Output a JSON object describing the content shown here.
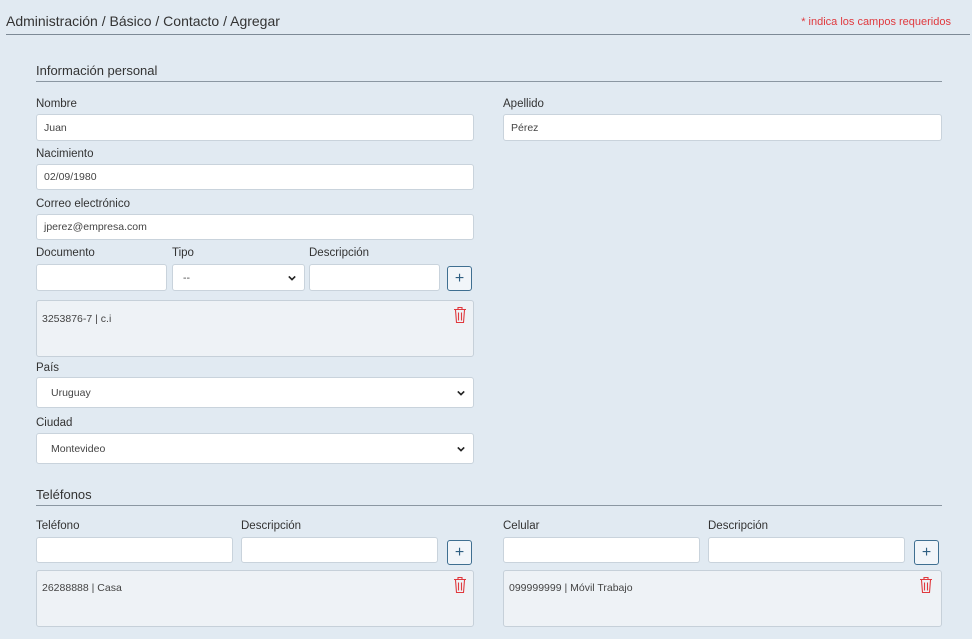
{
  "header": {
    "breadcrumb": "Administración / Básico / Contacto / Agregar",
    "required_note": "* indica los campos requeridos"
  },
  "personal": {
    "title": "Información personal",
    "nombre_label": "Nombre",
    "nombre_value": "Juan",
    "apellido_label": "Apellido",
    "apellido_value": "Pérez",
    "nacimiento_label": "Nacimiento",
    "nacimiento_value": "02/09/1980",
    "correo_label": "Correo electrónico",
    "correo_value": "jperez@empresa.com",
    "documento_label": "Documento",
    "documento_value": "",
    "tipo_label": "Tipo",
    "tipo_value": "--",
    "descripcion_label": "Descripción",
    "descripcion_value": "",
    "add_symbol": "+",
    "documents": [
      "3253876-7 | c.i"
    ],
    "pais_label": "País",
    "pais_value": "Uruguay",
    "ciudad_label": "Ciudad",
    "ciudad_value": "Montevideo"
  },
  "telefonos": {
    "title": "Teléfonos",
    "telefono_label": "Teléfono",
    "telefono_desc_label": "Descripción",
    "celular_label": "Celular",
    "celular_desc_label": "Descripción",
    "add_symbol": "+",
    "phones": [
      "26288888 | Casa"
    ],
    "mobiles": [
      "099999999 | Móvil Trabajo"
    ]
  },
  "icons": {
    "trash": "trash-icon",
    "chevron": "chevron-down-icon",
    "trash_color": "#e0393e"
  }
}
